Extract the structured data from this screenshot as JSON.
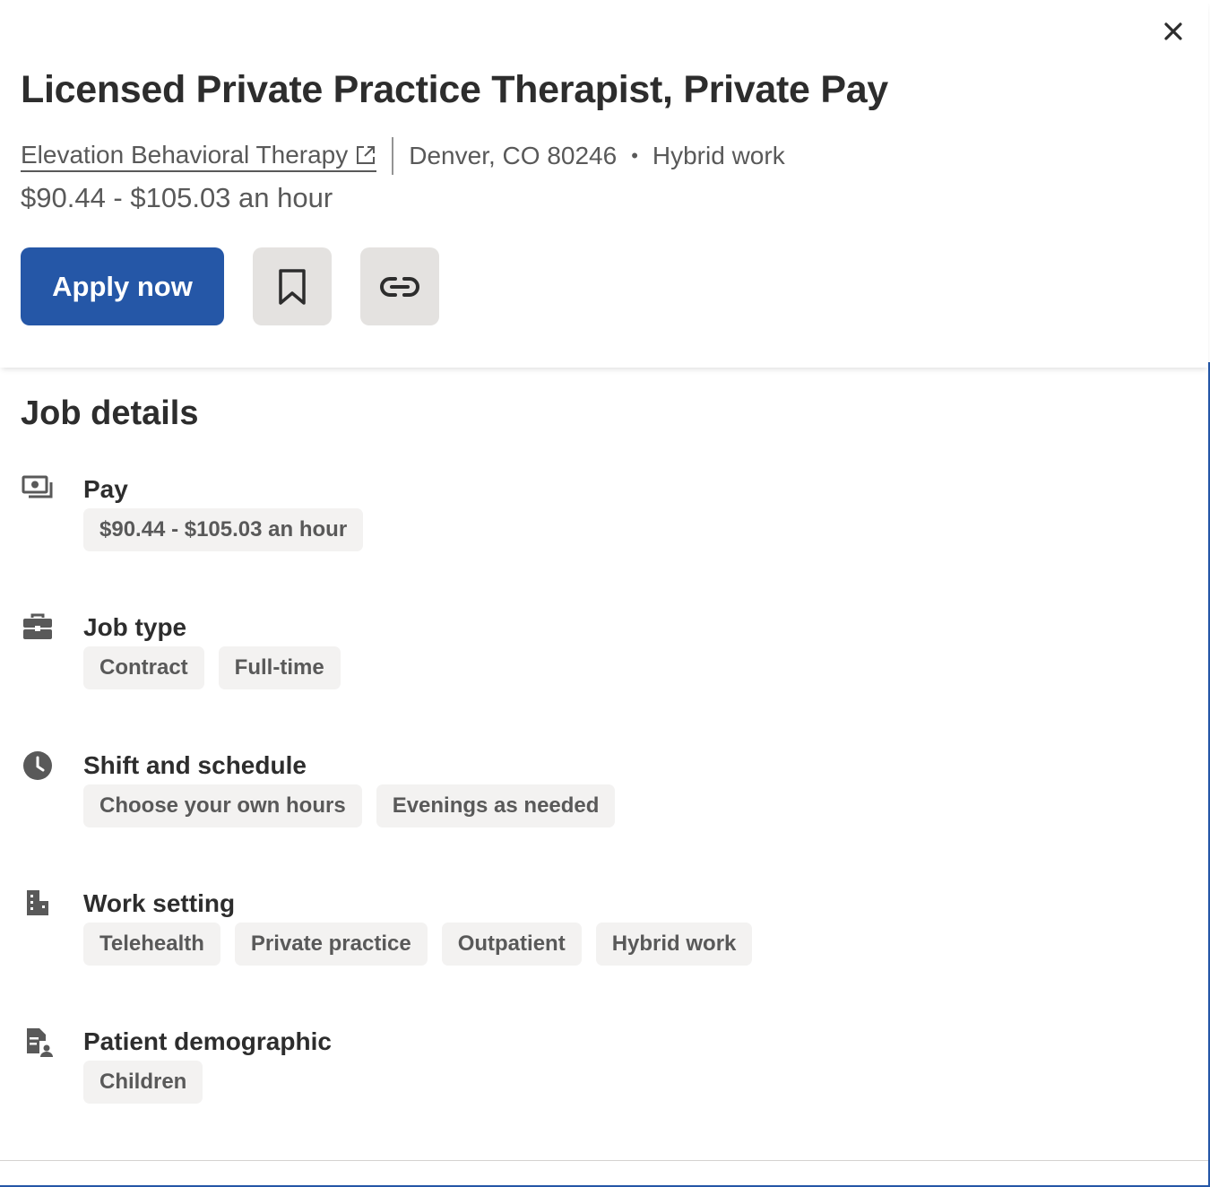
{
  "header": {
    "job_title": "Licensed Private Practice Therapist, Private Pay",
    "company": "Elevation Behavioral Therapy",
    "location": "Denver, CO 80246",
    "work_mode": "Hybrid work",
    "salary": "$90.44 - $105.03 an hour",
    "apply_label": "Apply now"
  },
  "details": {
    "title": "Job details",
    "sections": [
      {
        "label": "Pay",
        "icon": "money-icon",
        "chips": [
          "$90.44 - $105.03 an hour"
        ]
      },
      {
        "label": "Job type",
        "icon": "briefcase-icon",
        "chips": [
          "Contract",
          "Full-time"
        ]
      },
      {
        "label": "Shift and schedule",
        "icon": "clock-icon",
        "chips": [
          "Choose your own hours",
          "Evenings as needed"
        ]
      },
      {
        "label": "Work setting",
        "icon": "building-icon",
        "chips": [
          "Telehealth",
          "Private practice",
          "Outpatient",
          "Hybrid work"
        ]
      },
      {
        "label": "Patient demographic",
        "icon": "patient-document-icon",
        "chips": [
          "Children"
        ]
      }
    ]
  },
  "colors": {
    "brand": "#2557a7",
    "text": "#2d2d2d",
    "muted": "#595959",
    "chip_bg": "#f3f2f1",
    "icon_btn_bg": "#e4e2e0"
  }
}
